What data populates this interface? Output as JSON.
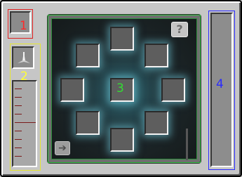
{
  "labels": {
    "slot1": "1",
    "lever": "2",
    "center": "3",
    "right": "4"
  },
  "buttons": {
    "help": "?",
    "exit": "➔"
  },
  "colors": {
    "label1": "#ff2a2a",
    "label2": "#ffff33",
    "label3": "#33dd33",
    "label4": "#2a2aff",
    "glow": "#7fd8ea"
  },
  "icons": {
    "lever": "lever-icon",
    "help": "question-mark-icon",
    "exit": "exit-arrow-icon"
  }
}
